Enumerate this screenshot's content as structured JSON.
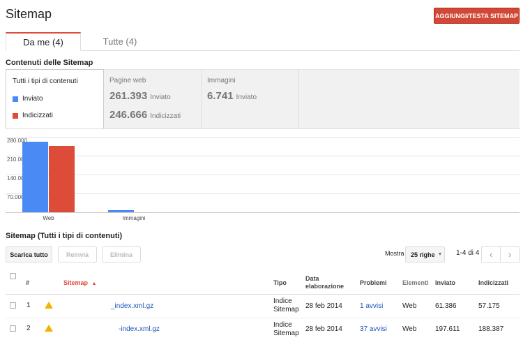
{
  "header": {
    "title": "Sitemap",
    "add_button": "AGGIUNGI/TESTA SITEMAP"
  },
  "tabs": [
    {
      "label": "Da me (4)",
      "active": true
    },
    {
      "label": "Tutte (4)",
      "active": false
    }
  ],
  "summary": {
    "section_title": "Contenuti delle Sitemap",
    "all_types": "Tutti i tipi di contenuti",
    "legend": [
      {
        "label": "Inviato",
        "color": "#4a8af4"
      },
      {
        "label": "Indicizzati",
        "color": "#dd4b39"
      }
    ],
    "columns": [
      {
        "title": "Pagine web",
        "submitted": "261.393",
        "submitted_label": "Inviato",
        "indexed": "246.666",
        "indexed_label": "Indicizzati"
      },
      {
        "title": "Immagini",
        "submitted": "6.741",
        "submitted_label": "Inviato"
      }
    ]
  },
  "chart_data": {
    "type": "bar",
    "categories": [
      "Web",
      "Immagini"
    ],
    "series": [
      {
        "name": "Inviato",
        "values": [
          261393,
          6741
        ],
        "color": "#4a8af4"
      },
      {
        "name": "Indicizzati",
        "values": [
          246666,
          0
        ],
        "color": "#dd4b39"
      }
    ],
    "yticks": [
      "280.000",
      "210.000",
      "140.000",
      "70.000"
    ],
    "ytick_values": [
      280000,
      210000,
      140000,
      70000
    ],
    "ylim": [
      0,
      280000
    ]
  },
  "table": {
    "section_title": "Sitemap (Tutti i tipi di contenuti)",
    "buttons": {
      "download": "Scarica tutto",
      "resend": "Reinvia",
      "delete": "Elimina"
    },
    "show_label": "Mostra",
    "rows_select": "25 righe",
    "pager_text": "1-4 di 4",
    "headers": {
      "num": "#",
      "sitemap": "Sitemap",
      "sort_arrow": "▲",
      "type": "Tipo",
      "date": "Data elaborazione",
      "problems": "Problemi",
      "items": "Elementi",
      "submitted": "Inviato",
      "indexed": "Indicizzati"
    },
    "rows": [
      {
        "num": "1",
        "sitemap": "_index.xml.gz",
        "type": "Indice Sitemap",
        "date": "28 feb 2014",
        "problems": "1 avvisi",
        "items": "Web",
        "submitted": "61.386",
        "indexed": "57.175"
      },
      {
        "num": "2",
        "sitemap": "-index.xml.gz",
        "type": "Indice Sitemap",
        "date": "28 feb 2014",
        "problems": "37 avvisi",
        "items": "Web",
        "submitted": "197.611",
        "indexed": "188.387"
      }
    ]
  }
}
